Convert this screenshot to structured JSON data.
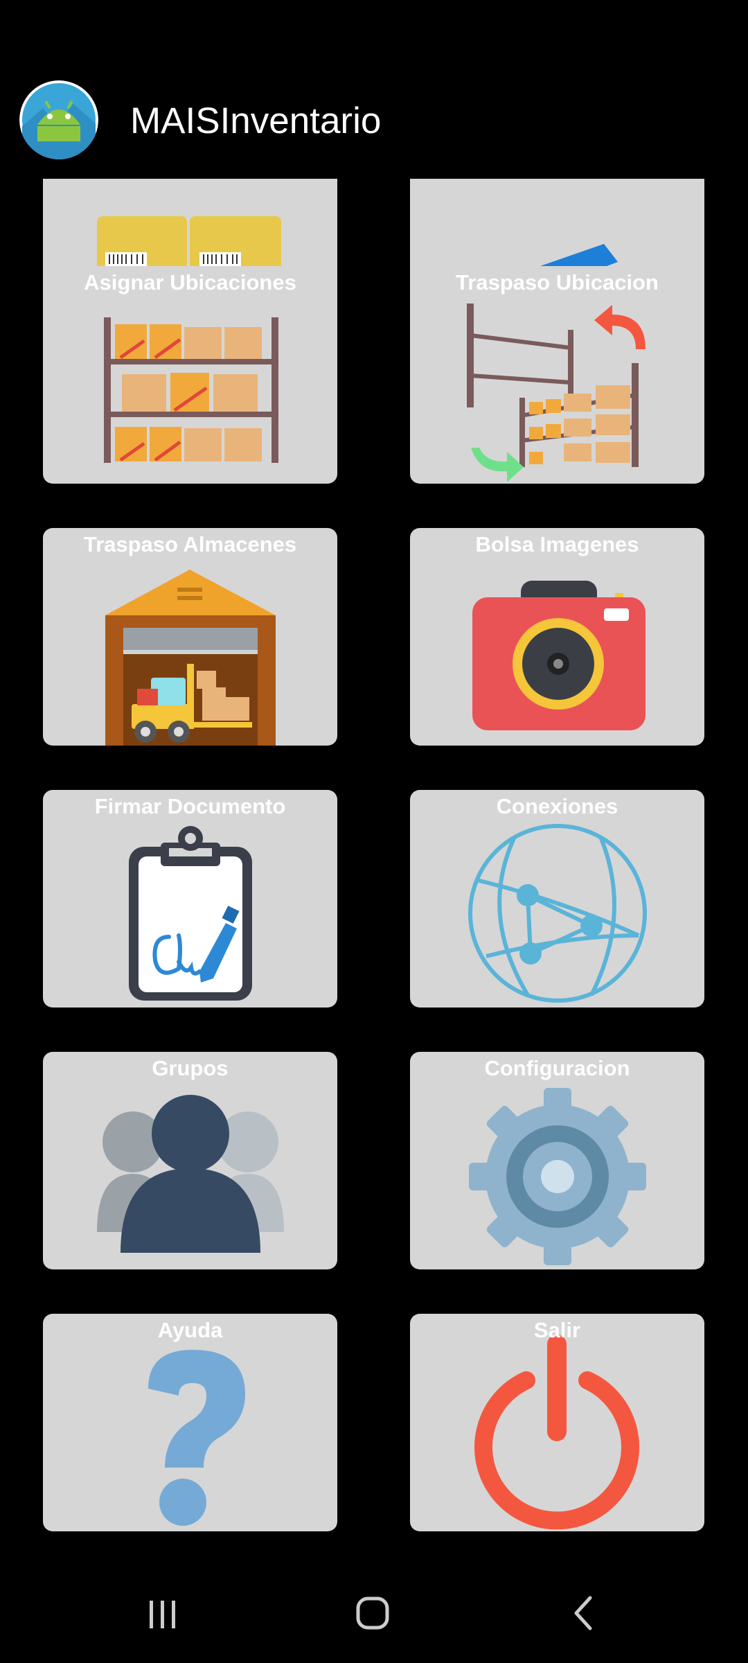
{
  "app": {
    "title": "MAISInventario",
    "logo_icon": "android-app-logo-icon"
  },
  "tiles": [
    {
      "label": "",
      "icon": "barcode-boxes-icon"
    },
    {
      "label": "",
      "icon": "blue-item-icon"
    },
    {
      "label": "Asignar Ubicaciones",
      "icon": "warehouse-shelf-icon"
    },
    {
      "label": "Traspaso Ubicacion",
      "icon": "shelf-transfer-icon"
    },
    {
      "label": "Traspaso Almacenes",
      "icon": "warehouse-forklift-icon"
    },
    {
      "label": "Bolsa Imagenes",
      "icon": "camera-icon"
    },
    {
      "label": "Firmar Documento",
      "icon": "clipboard-signature-icon"
    },
    {
      "label": "Conexiones",
      "icon": "network-globe-icon"
    },
    {
      "label": "Grupos",
      "icon": "group-people-icon"
    },
    {
      "label": "Configuracion",
      "icon": "gear-icon"
    },
    {
      "label": "Ayuda",
      "icon": "question-mark-icon"
    },
    {
      "label": "Salir",
      "icon": "power-icon"
    }
  ],
  "navbar": {
    "recents": "recent-apps-icon",
    "home": "home-icon",
    "back": "back-icon"
  },
  "colors": {
    "background": "#000000",
    "tile": "#d6d6d6",
    "tile_label": "#ffffff",
    "accent_blue": "#5ab4d8",
    "power_red": "#f4573f"
  }
}
